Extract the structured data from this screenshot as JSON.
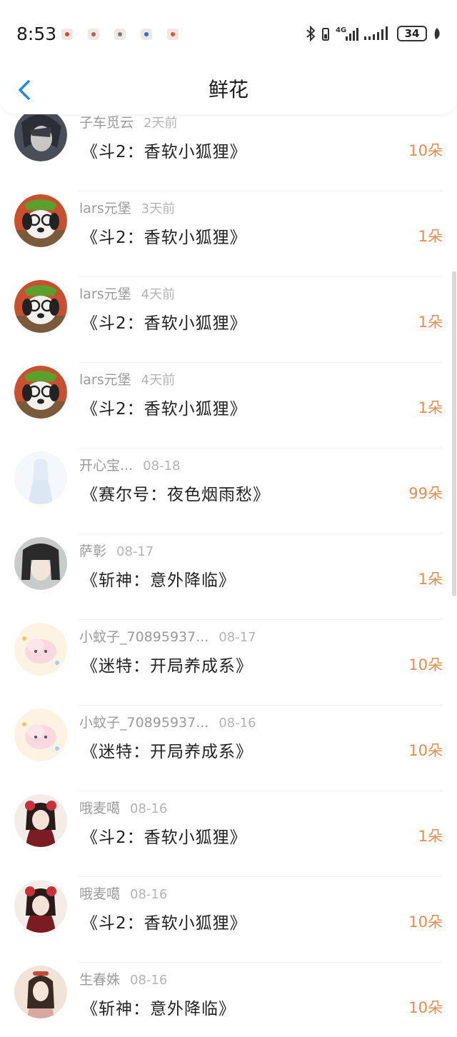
{
  "status_bar": {
    "time": "8:53",
    "battery": "34",
    "notification_icons": [
      "app-notif-icon-1",
      "app-notif-icon-2",
      "app-notif-icon-3",
      "app-notif-icon-4",
      "app-notif-icon-5"
    ],
    "system_icons": [
      "bluetooth-icon",
      "4g-signal-icon",
      "signal-icon",
      "battery-icon",
      "leaf-icon"
    ]
  },
  "header": {
    "title": "鲜花",
    "back_icon": "chevron-left-icon",
    "accent_color": "#1e88e5"
  },
  "colors": {
    "count": "#f08a4b",
    "name": "#9a9a9a",
    "time": "#b4b4b4",
    "title": "#222222"
  },
  "rows": [
    {
      "name": "子车觅云",
      "time": "2天前",
      "title": "《斗2：香软小狐狸》",
      "count": "10朵",
      "avatar": "anime-boy-avatar"
    },
    {
      "name": "lars元堡",
      "time": "3天前",
      "title": "《斗2：香软小狐狸》",
      "count": "1朵",
      "avatar": "dog-glasses-avatar"
    },
    {
      "name": "lars元堡",
      "time": "4天前",
      "title": "《斗2：香软小狐狸》",
      "count": "1朵",
      "avatar": "dog-glasses-avatar"
    },
    {
      "name": "lars元堡",
      "time": "4天前",
      "title": "《斗2：香软小狐狸》",
      "count": "1朵",
      "avatar": "dog-glasses-avatar"
    },
    {
      "name": "开心宝...",
      "time": "08-18",
      "title": "《赛尔号：夜色烟雨愁》",
      "count": "99朵",
      "avatar": "white-fairy-avatar"
    },
    {
      "name": "萨彰",
      "time": "08-17",
      "title": "《斩神：意外降临》",
      "count": "1朵",
      "avatar": "anime-girl-avatar"
    },
    {
      "name": "小蚊子_70895937...",
      "time": "08-17",
      "title": "《迷特：开局养成系》",
      "count": "10朵",
      "avatar": "pink-cloud-avatar"
    },
    {
      "name": "小蚊子_70895937...",
      "time": "08-16",
      "title": "《迷特：开局养成系》",
      "count": "10朵",
      "avatar": "pink-cloud-avatar"
    },
    {
      "name": "哦麦噶",
      "time": "08-16",
      "title": "《斗2：香软小狐狸》",
      "count": "1朵",
      "avatar": "red-flower-girl-avatar"
    },
    {
      "name": "哦麦噶",
      "time": "08-16",
      "title": "《斗2：香软小狐狸》",
      "count": "10朵",
      "avatar": "red-flower-girl-avatar"
    },
    {
      "name": "生春姝",
      "time": "08-16",
      "title": "《斩神：意外降临》",
      "count": "10朵",
      "avatar": "ancient-girl-avatar"
    }
  ]
}
